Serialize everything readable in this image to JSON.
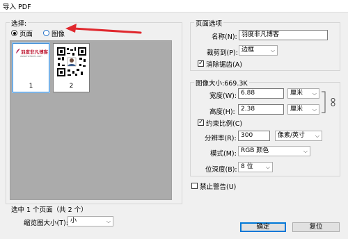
{
  "window": {
    "title": "导入 PDF"
  },
  "left": {
    "legend": "选择:",
    "radio_page": "页面",
    "radio_image": "图像",
    "thumbs": [
      {
        "label": "1",
        "brand": "羽度非凡博客",
        "url": "www.hellonic.com"
      },
      {
        "label": "2"
      }
    ],
    "status": "选中 1 个页面（共 2 个）",
    "thumb_size_label": "缩览图大小(T):",
    "thumb_size_value": "小",
    "annotation_color": "#e0282e"
  },
  "page_options": {
    "legend": "页面选项",
    "name_label": "名称(N):",
    "name_value": "羽度非凡博客",
    "crop_label": "裁剪到(P):",
    "crop_value": "边框",
    "antialias_label": "消除锯齿(A)"
  },
  "image_size": {
    "legend": "图像大小:669.3K",
    "width_label": "宽度(W):",
    "width_value": "6.88",
    "width_unit": "厘米",
    "height_label": "高度(H):",
    "height_value": "2.38",
    "height_unit": "厘米",
    "constrain_label": "约束比例(C)",
    "res_label": "分辨率(R):",
    "res_value": "300",
    "res_unit": "像素/英寸",
    "mode_label": "模式(M):",
    "mode_value": "RGB 颜色",
    "depth_label": "位深度(B):",
    "depth_value": "8 位"
  },
  "suppress_label": "禁止警告(U)",
  "buttons": {
    "ok": "确定",
    "reset": "复位"
  }
}
